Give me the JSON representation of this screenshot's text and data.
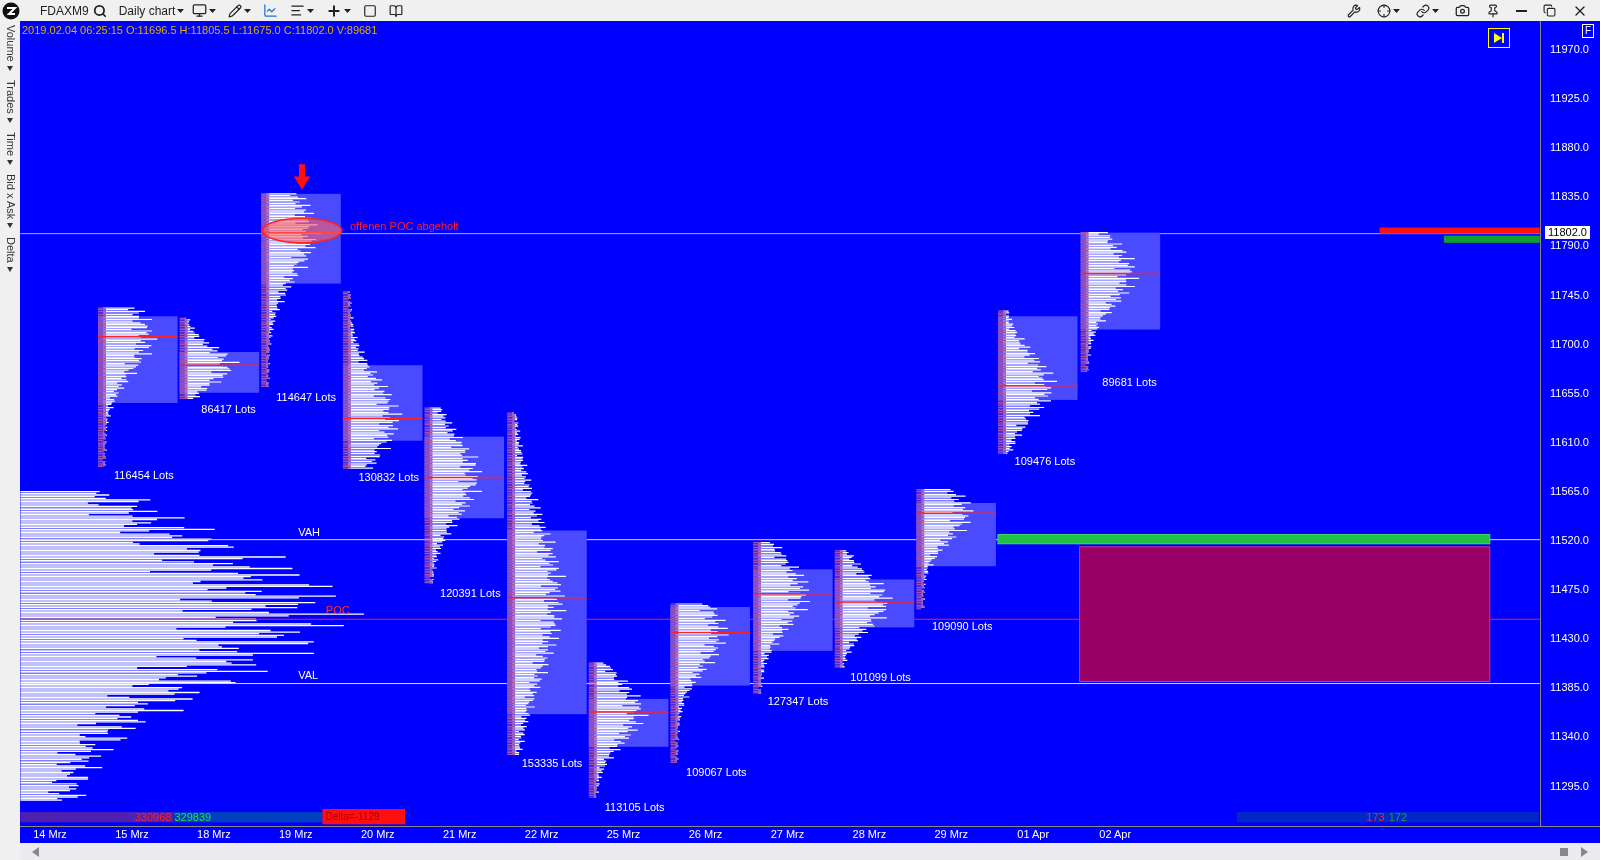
{
  "toolbar": {
    "instrument": "FDAXM9",
    "chart_type": "Daily chart"
  },
  "side_tabs": [
    "Volume",
    "Trades",
    "Time",
    "Bid x Ask",
    "Delta"
  ],
  "info_line": "2019.02.04 06:25:15 O:11696.5 H:11805.5 L:11675.0 C:11802.0 V:89681",
  "price_axis": {
    "corner": "F",
    "current": "11802.0",
    "ticks": [
      "11970.0",
      "11925.0",
      "11880.0",
      "11835.0",
      "11790.0",
      "11745.0",
      "11700.0",
      "11655.0",
      "11610.0",
      "11565.0",
      "11520.0",
      "11475.0",
      "11430.0",
      "11385.0",
      "11340.0",
      "11295.0"
    ]
  },
  "profiles": [
    {
      "label": "116454 Lots"
    },
    {
      "label": "86417 Lots"
    },
    {
      "label": "114647 Lots"
    },
    {
      "label": "130832 Lots"
    },
    {
      "label": "120391 Lots"
    },
    {
      "label": "153335 Lots"
    },
    {
      "label": "113105 Lots"
    },
    {
      "label": "109067 Lots"
    },
    {
      "label": "127347 Lots"
    },
    {
      "label": "101099 Lots"
    },
    {
      "label": "109090 Lots"
    },
    {
      "label": "109476 Lots"
    },
    {
      "label": "89681 Lots"
    }
  ],
  "composite": {
    "vah": "VAH",
    "poc": "POC",
    "val": "VAL"
  },
  "annotation": "offenen POC abgeholt",
  "summary_bar": {
    "left_red": "330968",
    "left_green": "329839",
    "delta": "Delta=-1129",
    "right_red": "173",
    "right_green": "172"
  },
  "dates": [
    "14 Mrz",
    "15 Mrz",
    "18 Mrz",
    "19 Mrz",
    "20 Mrz",
    "21 Mrz",
    "22 Mrz",
    "25 Mrz",
    "26 Mrz",
    "27 Mrz",
    "28 Mrz",
    "29 Mrz",
    "01 Apr",
    "02 Apr"
  ]
}
